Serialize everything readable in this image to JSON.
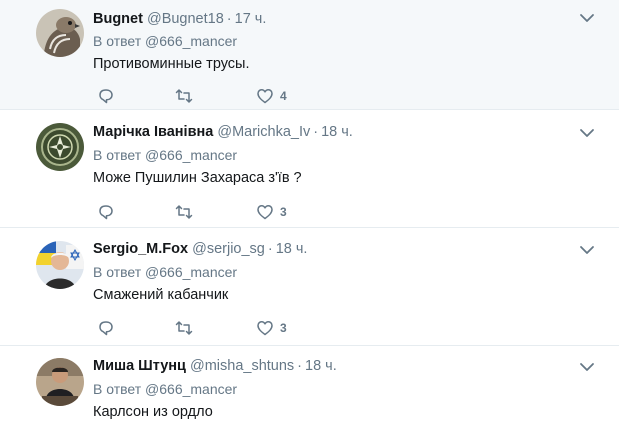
{
  "reply_prefix": "В ответ",
  "colors": {
    "icon": "#657786",
    "highlight": "#f5f8fa",
    "border": "#e6ecf0"
  },
  "icons": [
    "reply-icon",
    "retweet-icon",
    "like-icon",
    "chevron-down-icon"
  ],
  "tweets": [
    {
      "name": "Bugnet",
      "handle": "@Bugnet18",
      "time": "17 ч.",
      "reply_to": "@666_mancer",
      "text": "Противоминные трусы.",
      "likes": "4",
      "avatar": "hawk"
    },
    {
      "name": "Марічка Іванівна",
      "handle": "@Marichka_Iv",
      "time": "18 ч.",
      "reply_to": "@666_mancer",
      "text": "Може Пушилин  Захараса з'їв ?",
      "likes": "3",
      "avatar": "emblem"
    },
    {
      "name": "Sergio_M.Fox",
      "handle": "@serjio_sg",
      "time": "18 ч.",
      "reply_to": "@666_mancer",
      "text": "Смажений кабанчик",
      "likes": "3",
      "avatar": "man-flags"
    },
    {
      "name": "Миша Штунц",
      "handle": "@misha_shtuns",
      "time": "18 ч.",
      "reply_to": "@666_mancer",
      "text": "Карлсон из ордло",
      "likes": "",
      "avatar": "man-sitting"
    }
  ]
}
